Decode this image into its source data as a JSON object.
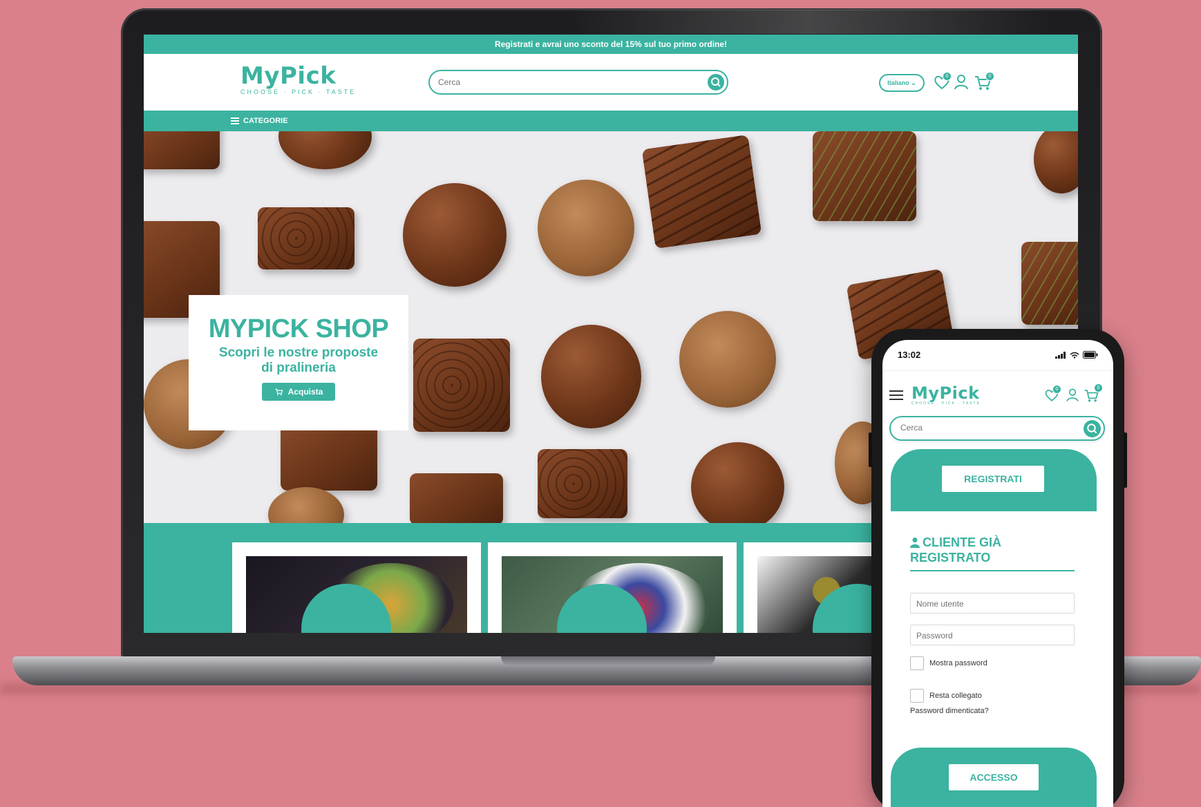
{
  "colors": {
    "background": "#d9808a",
    "brand_teal": "#3bb3a0",
    "white": "#ffffff"
  },
  "desktop": {
    "promo_banner": "Registrati e avrai uno sconto del 15% sul tuo primo ordine!",
    "logo": {
      "word": "MyPick",
      "tagline": "CHOOSE · PICK · TASTE"
    },
    "search": {
      "placeholder": "Cerca"
    },
    "language": {
      "selected": "Italiano ⌄"
    },
    "wishlist_count": "0",
    "cart_count": "0",
    "categories_label": "CATEGORIE",
    "hero": {
      "title": "MYPICK SHOP",
      "subtitle_line1": "Scopri le nostre proposte",
      "subtitle_line2": "di pralineria",
      "button_label": "Acquista"
    },
    "icons": [
      "search-icon",
      "heart-icon",
      "user-icon",
      "cart-icon",
      "menu-icon"
    ]
  },
  "mobile": {
    "status_time": "13:02",
    "logo": {
      "word": "MyPick",
      "tagline": "CHOOSE · PICK · TASTE"
    },
    "wishlist_count": "0",
    "cart_count": "0",
    "search": {
      "placeholder": "Cerca"
    },
    "register_button": "REGISTRATI",
    "login_title_line1": "CLIENTE GIÀ",
    "login_title_line2": "REGISTRATO",
    "username_placeholder": "Nome utente",
    "password_placeholder": "Password",
    "show_password_label": "Mostra password",
    "stay_logged_label": "Resta collegato",
    "forgot_password": "Password dimenticata?",
    "login_button": "ACCESSO"
  }
}
